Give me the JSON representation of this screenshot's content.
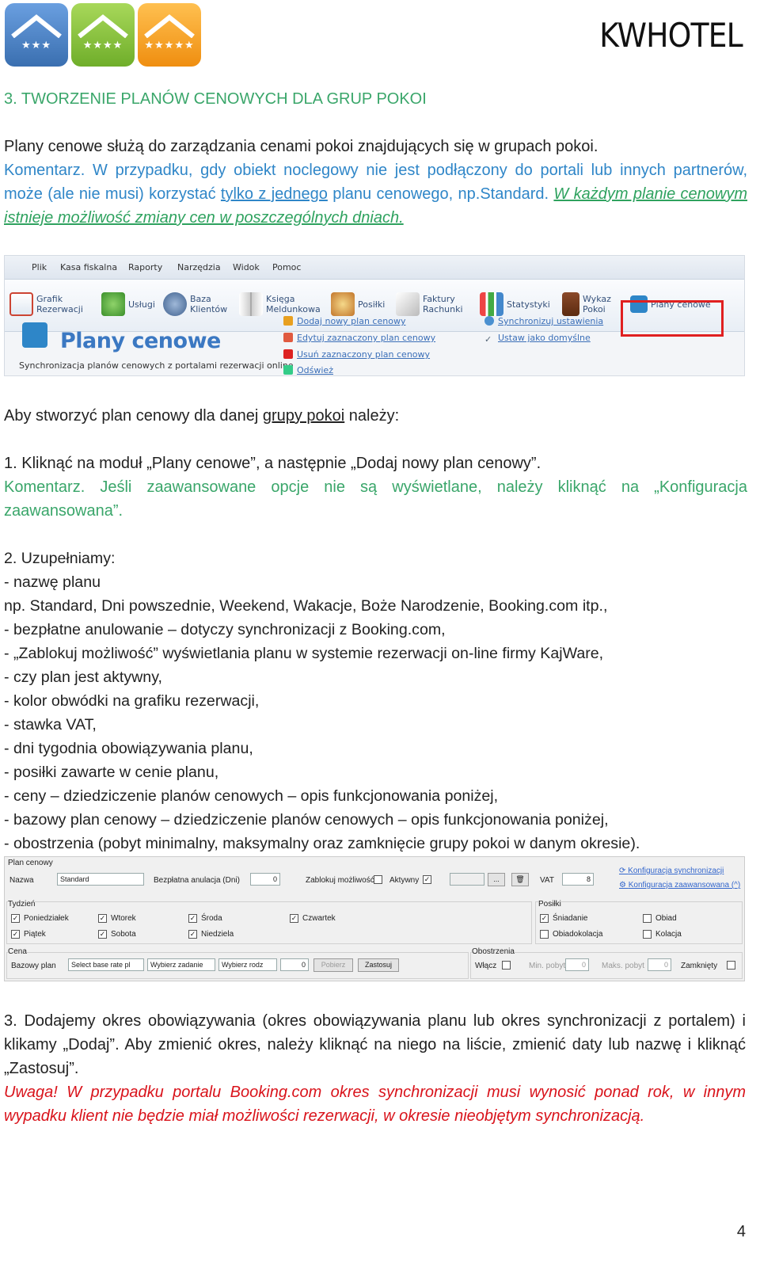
{
  "header": {
    "logos": [
      {
        "stars": "★★★",
        "color": "#4a7fc0"
      },
      {
        "stars": "★★★★",
        "color": "#8bc43f"
      },
      {
        "stars": "★★★★★",
        "color": "#f5a21e"
      }
    ],
    "brand": "KWHOTEL"
  },
  "section_title": "3. TWORZENIE PLANÓW CENOWYCH DLA GRUP POKOI",
  "intro": {
    "line1": "Plany cenowe służą do zarządzania cenami pokoi znajdujących się w grupach pokoi.",
    "comment_a": "Komentarz. W przypadku, gdy obiekt noclegowy nie jest podłączony do portali lub innych partnerów, może (ale nie musi) korzystać ",
    "comment_u": "tylko z jednego",
    "comment_b": " planu cenowego, np.Standard. ",
    "comment_link": "W każdym planie cenowym istnieje możliwość zmiany cen w poszczególnych dniach."
  },
  "screenshot1": {
    "menu": [
      "Plik",
      "Kasa fiskalna",
      "Raporty",
      "Narzędzia",
      "Widok",
      "Pomoc"
    ],
    "ribbon": [
      {
        "label": "Grafik Rezerwacji",
        "icon": "calendar-icon"
      },
      {
        "label": "Usługi",
        "icon": "services-icon"
      },
      {
        "label": "Baza Klientów",
        "icon": "clients-icon"
      },
      {
        "label": "Księga Meldunkowa",
        "icon": "book-icon"
      },
      {
        "label": "Posiłki",
        "icon": "meals-icon"
      },
      {
        "label": "Faktury Rachunki",
        "icon": "invoice-icon"
      },
      {
        "label": "Statystyki",
        "icon": "stats-icon"
      },
      {
        "label": "Wykaz Pokoi",
        "icon": "door-icon"
      },
      {
        "label": "Plany cenowe",
        "icon": "price-plan-icon"
      }
    ],
    "big_title": "Plany cenowe",
    "sync_caption": "Synchronizacja planów cenowych z portalami rezerwacji online",
    "actions": [
      "Dodaj nowy plan cenowy",
      "Edytuj zaznaczony plan cenowy",
      "Usuń zaznaczony plan cenowy",
      "Odśwież"
    ],
    "actions_right": [
      "Synchronizuj ustawienia",
      "Ustaw jako domyślne"
    ]
  },
  "steps_intro": {
    "a": "Aby stworzyć plan cenowy dla danej ",
    "u": "grupy pokoi",
    "b": " należy:"
  },
  "step1": "1. Kliknąć na moduł „Plany cenowe”, a następnie „Dodaj nowy plan cenowy”.",
  "step1_comment": "Komentarz. Jeśli zaawansowane opcje nie są wyświetlane, należy kliknąć na „Konfiguracja zaawansowana”.",
  "step2": {
    "title": "2. Uzupełniamy:",
    "items": [
      "- nazwę planu",
      "np. Standard, Dni powszednie, Weekend, Wakacje, Boże Narodzenie, Booking.com itp.,",
      "- bezpłatne anulowanie – dotyczy synchronizacji z Booking.com,",
      "- „Zablokuj możliwość” wyświetlania planu w systemie rezerwacji on-line firmy KajWare,",
      "- czy plan jest aktywny,",
      "- kolor obwódki na grafiku rezerwacji,",
      "- stawka VAT,",
      "- dni tygodnia obowiązywania planu,",
      "- posiłki zawarte w cenie planu,",
      "- ceny – dziedziczenie planów cenowych – opis funkcjonowania poniżej,",
      "- bazowy plan cenowy – dziedziczenie planów cenowych – opis funkcjonowania poniżej,",
      "- obostrzenia (pobyt minimalny, maksymalny oraz zamknięcie grupy pokoi w danym okresie)."
    ]
  },
  "screenshot2": {
    "group_title": "Plan cenowy",
    "name_label": "Nazwa",
    "name_value": "Standard",
    "free_cancel_label": "Bezpłatna anulacja (Dni)",
    "free_cancel_value": "0",
    "block_label": "Zablokuj możliwość",
    "active_label": "Aktywny",
    "color_button": "...",
    "vat_label": "VAT",
    "vat_value": "8",
    "link_sync": "Konfiguracja synchronizacji",
    "link_adv": "Konfiguracja zaawansowana (^)",
    "days_title": "Tydzień",
    "days": [
      "Poniedziałek",
      "Wtorek",
      "Środa",
      "Czwartek",
      "Piątek",
      "Sobota",
      "Niedziela"
    ],
    "meals_title": "Posiłki",
    "meals": [
      "Śniadanie",
      "Obiad",
      "Obiadokolacja",
      "Kolacja"
    ],
    "price_title": "Cena",
    "base_plan_label": "Bazowy plan",
    "base_select": "Select base rate pl",
    "task_select": "Wybierz zadanie",
    "kind_select": "Wybierz rodz",
    "num_value": "0",
    "fetch_button": "Pobierz",
    "apply_button": "Zastosuj",
    "restr_title": "Obostrzenia",
    "include_label": "Włącz",
    "min_label": "Min. pobyt",
    "min_value": "0",
    "max_label": "Maks. pobyt",
    "max_value": "0",
    "close_label": "Zamknięty"
  },
  "step3": "3. Dodajemy okres obowiązywania (okres obowiązywania planu lub okres synchronizacji z portalem) i klikamy „Dodaj”. Aby zmienić okres, należy kliknąć na niego na liście, zmienić daty lub nazwę i kliknąć „Zastosuj”.",
  "warning": "Uwaga! W przypadku portalu Booking.com okres synchronizacji musi wynosić ponad rok, w innym wypadku klient nie będzie miał możliwości rezerwacji, w okresie nieobjętym synchronizacją.",
  "page_number": "4"
}
